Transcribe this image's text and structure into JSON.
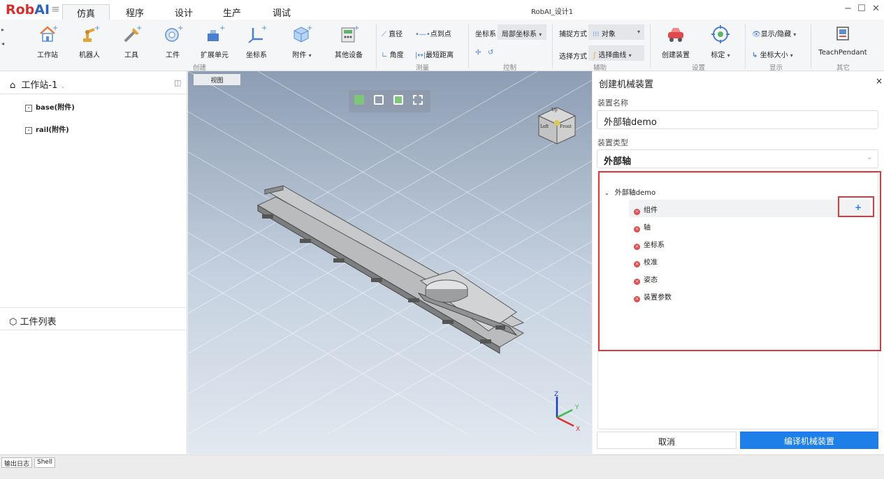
{
  "app": {
    "logo_rob": "Rob",
    "logo_ai": "AI",
    "title": "RobAI_设计1"
  },
  "menu_tabs": [
    "仿真",
    "程序",
    "设计",
    "生产",
    "调试"
  ],
  "window_controls": [
    "−",
    "☐",
    "✕"
  ],
  "ribbon": {
    "create": {
      "buttons": [
        "工作站",
        "机器人",
        "工具",
        "工件",
        "扩展单元",
        "坐标系",
        "附件",
        "其他设备"
      ],
      "group_label": "创建"
    },
    "measure": {
      "diameter": "直径",
      "point_to_point": "点到点",
      "angle": "角度",
      "shortest_distance": "最短距离",
      "group_label": "测量"
    },
    "control": {
      "coord_label": "坐标系",
      "coord_value": "局部坐标系",
      "group_label": "控制"
    },
    "assist": {
      "capture_label": "捕捉方式",
      "capture_value": "对象",
      "select_label": "选择方式",
      "select_value": "选择曲线",
      "group_label": "辅助"
    },
    "settings": {
      "create_device": "创建装置",
      "calibrate": "标定",
      "group_label": "设置"
    },
    "display": {
      "show_hide": "显示/隐藏",
      "coord_size": "坐标大小",
      "group_label": "显示"
    },
    "other": {
      "teach_pendant": "TeachPendant",
      "group_label": "其它"
    }
  },
  "left_panel": {
    "station": "工作站-1",
    "items": [
      "base(附件)",
      "rail(附件)"
    ],
    "workpiece_list": "工件列表"
  },
  "viewport": {
    "tab": "视图",
    "cube": {
      "top": "Up",
      "left": "Left",
      "front": "Front"
    },
    "axes": {
      "x": "X",
      "y": "Y",
      "z": "Z"
    }
  },
  "right_panel": {
    "title": "创建机械装置",
    "close": "×",
    "name_label": "装置名称",
    "name_value": "外部轴demo",
    "type_label": "装置类型",
    "type_value": "外部轴",
    "tree_root": "外部轴demo",
    "tree_items": [
      "组件",
      "轴",
      "坐标系",
      "校准",
      "姿态",
      "装置参数"
    ],
    "add": "+",
    "cancel": "取消",
    "compile": "编译机械装置"
  },
  "footer": {
    "tabs": [
      "输出日志",
      "Shell"
    ]
  },
  "colors": {
    "accent": "#1f7fe8",
    "highlight": "#d93b3b",
    "logo_red": "#d72d2d",
    "logo_blue": "#2b64b8"
  }
}
